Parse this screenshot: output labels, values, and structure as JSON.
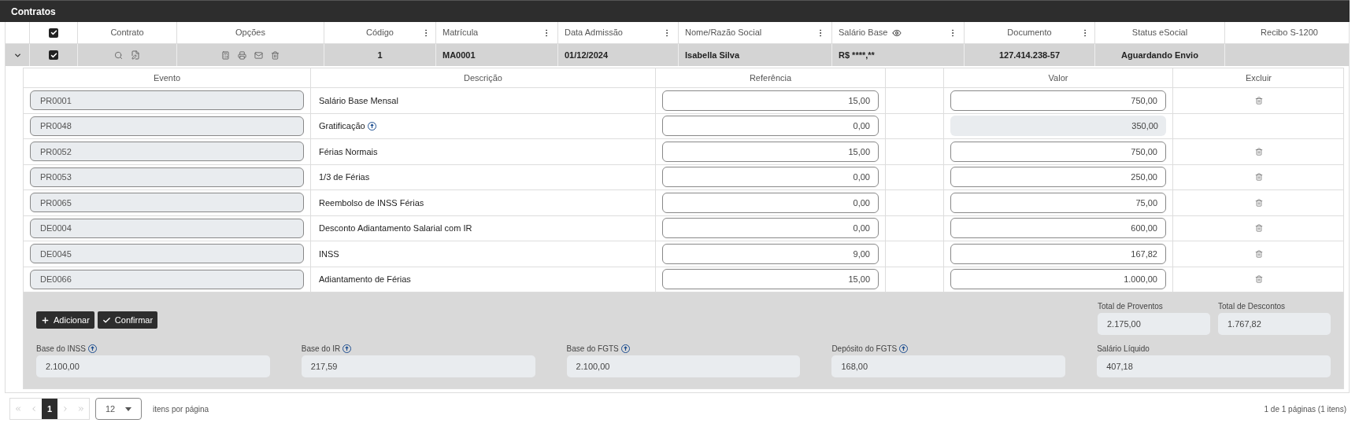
{
  "panel_title": "Contratos",
  "columns": [
    {
      "kind": "checkbox",
      "checked": true
    },
    {
      "kind": "text",
      "label": "Contrato",
      "menu": false,
      "eye": false
    },
    {
      "kind": "text",
      "label": "Opções",
      "menu": false,
      "eye": false
    },
    {
      "kind": "text",
      "label": "Código",
      "menu": true,
      "eye": false
    },
    {
      "kind": "text",
      "label": "Matrícula",
      "menu": true,
      "eye": false
    },
    {
      "kind": "text",
      "label": "Data Admissão",
      "menu": true,
      "eye": false
    },
    {
      "kind": "text",
      "label": "Nome/Razão Social",
      "menu": true,
      "eye": false
    },
    {
      "kind": "text",
      "label": "Salário Base",
      "menu": true,
      "eye": true
    },
    {
      "kind": "text",
      "label": "Documento",
      "menu": true,
      "eye": false
    },
    {
      "kind": "text",
      "label": "Status eSocial",
      "menu": false,
      "eye": false
    },
    {
      "kind": "text",
      "label": "Recibo S-1200",
      "menu": false,
      "eye": false
    }
  ],
  "contract": {
    "expanded": true,
    "checked": true,
    "codigo": "1",
    "matricula": "MA0001",
    "data_admissao": "01/12/2024",
    "nome": "Isabella Silva",
    "salario_base": "R$ ****,**",
    "documento": "127.414.238-57",
    "status_esocial": "Aguardando Envio"
  },
  "events_columns": [
    "Evento",
    "Descrição",
    "Referência",
    "Valor",
    "Excluir"
  ],
  "events": [
    {
      "evento": "PR0001",
      "descricao": "Salário Base Mensal",
      "info": false,
      "referencia": "15,00",
      "valor": "750,00",
      "valor_disabled": false,
      "deletable": true
    },
    {
      "evento": "PR0048",
      "descricao": "Gratificação",
      "info": true,
      "referencia": "0,00",
      "valor": "350,00",
      "valor_disabled": true,
      "deletable": false
    },
    {
      "evento": "PR0052",
      "descricao": "Férias Normais",
      "info": false,
      "referencia": "15,00",
      "valor": "750,00",
      "valor_disabled": false,
      "deletable": true
    },
    {
      "evento": "PR0053",
      "descricao": "1/3 de Férias",
      "info": false,
      "referencia": "0,00",
      "valor": "250,00",
      "valor_disabled": false,
      "deletable": true
    },
    {
      "evento": "PR0065",
      "descricao": "Reembolso de INSS Férias",
      "info": false,
      "referencia": "0,00",
      "valor": "75,00",
      "valor_disabled": false,
      "deletable": true
    },
    {
      "evento": "DE0004",
      "descricao": "Desconto Adiantamento Salarial com IR",
      "info": false,
      "referencia": "0,00",
      "valor": "600,00",
      "valor_disabled": false,
      "deletable": true
    },
    {
      "evento": "DE0045",
      "descricao": "INSS",
      "info": false,
      "referencia": "9,00",
      "valor": "167,82",
      "valor_disabled": false,
      "deletable": true
    },
    {
      "evento": "DE0066",
      "descricao": "Adiantamento de Férias",
      "info": false,
      "referencia": "15,00",
      "valor": "1.000,00",
      "valor_disabled": false,
      "deletable": true
    }
  ],
  "buttons": [
    {
      "kind": "add",
      "label": "Adicionar"
    },
    {
      "kind": "confirm",
      "label": "Confirmar"
    }
  ],
  "totals": [
    {
      "label": "Total de Proventos",
      "value": "2.175,00"
    },
    {
      "label": "Total de Descontos",
      "value": "1.767,82"
    }
  ],
  "bases": [
    {
      "label": "Base do INSS",
      "info": true,
      "value": "2.100,00"
    },
    {
      "label": "Base do IR",
      "info": true,
      "value": "217,59"
    },
    {
      "label": "Base do FGTS",
      "info": true,
      "value": "2.100,00"
    },
    {
      "label": "Depósito do FGTS",
      "info": true,
      "value": "168,00"
    },
    {
      "label": "Salário Líquido",
      "info": false,
      "value": "407,18"
    }
  ],
  "pagination": {
    "pages": [
      {
        "label": "1",
        "selected": true
      }
    ],
    "page_size": "12",
    "page_size_label": "itens por página",
    "summary": "1 de 1 páginas (1 itens)"
  }
}
